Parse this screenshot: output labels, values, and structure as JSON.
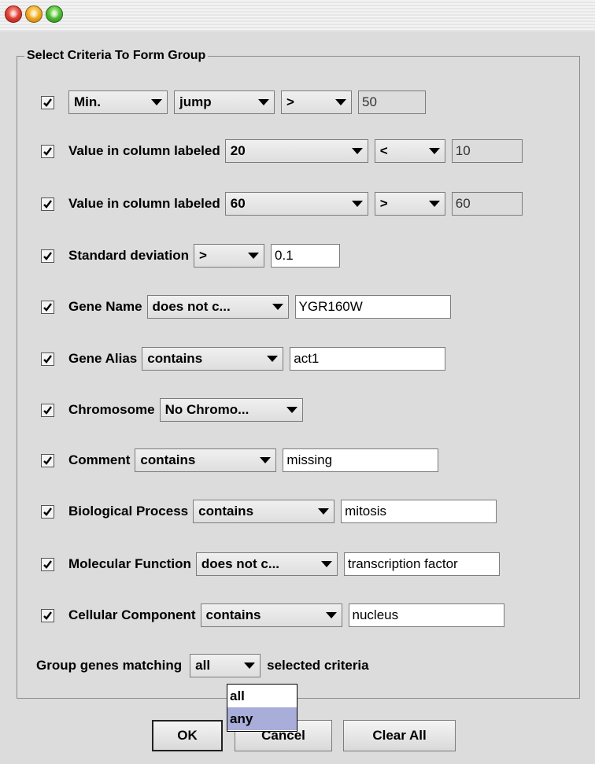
{
  "window": {
    "group_title": "Select Criteria To Form Group"
  },
  "criteria": [
    {
      "label": "",
      "combos": [
        "Min.",
        "jump",
        ">"
      ],
      "value": "50",
      "checked": true
    },
    {
      "label": "Value in column labeled",
      "combos": [
        "20",
        "<"
      ],
      "value": "10",
      "checked": true
    },
    {
      "label": "Value in column labeled",
      "combos": [
        "60",
        ">"
      ],
      "value": "60",
      "checked": true
    },
    {
      "label": "Standard deviation",
      "combos": [
        ">"
      ],
      "value": "0.1",
      "checked": true
    },
    {
      "label": "Gene Name",
      "combos": [
        "does not c..."
      ],
      "value": "YGR160W",
      "checked": true
    },
    {
      "label": "Gene Alias",
      "combos": [
        "contains"
      ],
      "value": "act1",
      "checked": true
    },
    {
      "label": "Chromosome",
      "combos": [
        "No Chromo..."
      ],
      "value": "",
      "checked": true
    },
    {
      "label": "Comment",
      "combos": [
        "contains"
      ],
      "value": "missing",
      "checked": true
    },
    {
      "label": "Biological Process",
      "combos": [
        "contains"
      ],
      "value": "mitosis",
      "checked": true
    },
    {
      "label": "Molecular Function",
      "combos": [
        "does not c..."
      ],
      "value": "transcription factor",
      "checked": true
    },
    {
      "label": "Cellular Component",
      "combos": [
        "contains"
      ],
      "value": "nucleus",
      "checked": true
    }
  ],
  "matching": {
    "prefix": "Group genes matching",
    "selected": "all",
    "suffix": "selected criteria",
    "options": [
      "all",
      "any"
    ],
    "highlighted": "any"
  },
  "buttons": {
    "ok": "OK",
    "cancel": "Cancel",
    "clear_all": "Clear All"
  }
}
